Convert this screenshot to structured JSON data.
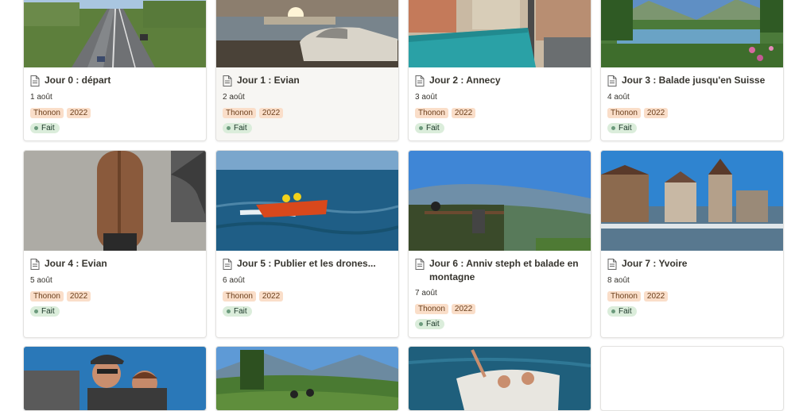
{
  "cards": [
    {
      "title": "Jour 0 : départ",
      "date": "1 août",
      "tags": [
        "Thonon",
        "2022"
      ],
      "status": "Fait"
    },
    {
      "title": "Jour 1 : Evian",
      "date": "2 août",
      "tags": [
        "Thonon",
        "2022"
      ],
      "status": "Fait"
    },
    {
      "title": "Jour 2 : Annecy",
      "date": "3 août",
      "tags": [
        "Thonon",
        "2022"
      ],
      "status": "Fait"
    },
    {
      "title": "Jour 3 : Balade jusqu'en Suisse",
      "date": "4 août",
      "tags": [
        "Thonon",
        "2022"
      ],
      "status": "Fait"
    },
    {
      "title": "Jour 4 : Evian",
      "date": "5 août",
      "tags": [
        "Thonon",
        "2022"
      ],
      "status": "Fait"
    },
    {
      "title": "Jour 5 : Publier et les drones...",
      "date": "6 août",
      "tags": [
        "Thonon",
        "2022"
      ],
      "status": "Fait"
    },
    {
      "title": "Jour 6 : Anniv steph et balade en montagne",
      "date": "7 août",
      "tags": [
        "Thonon",
        "2022"
      ],
      "status": "Fait"
    },
    {
      "title": "Jour 7 : Yvoire",
      "date": "8 août",
      "tags": [
        "Thonon",
        "2022"
      ],
      "status": "Fait"
    }
  ],
  "colors": {
    "tag_bg": "#fadec9",
    "status_bg": "#dbeddb",
    "status_dot": "#6c9b7d",
    "card_border": "#e3e2e0"
  }
}
